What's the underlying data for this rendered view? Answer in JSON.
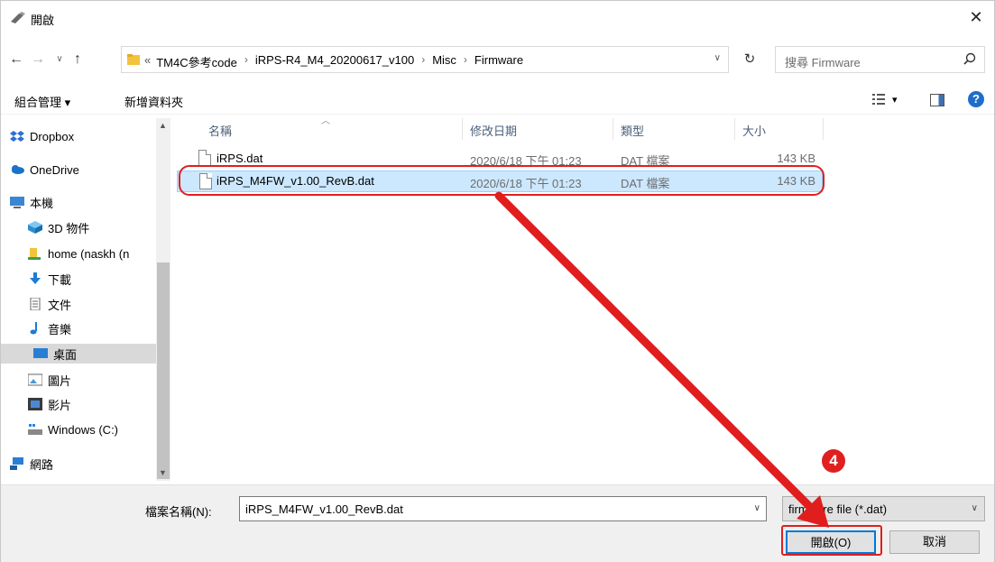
{
  "window": {
    "title": "開啟",
    "close_glyph": "✕"
  },
  "nav": {
    "back": "←",
    "forward": "→",
    "recent": "∨",
    "up": "↑",
    "refresh": "↻"
  },
  "address": {
    "overflow": "«",
    "crumbs": [
      "TM4C參考code",
      "iRPS-R4_M4_20200617_v100",
      "Misc",
      "Firmware"
    ],
    "separator": "›",
    "dropdown": "∨"
  },
  "search": {
    "placeholder": "搜尋 Firmware"
  },
  "toolbar": {
    "organize": "組合管理 ▾",
    "new_folder": "新增資料夾",
    "view_menu": "▾"
  },
  "sidebar": {
    "items": [
      {
        "label": "Dropbox",
        "icon": "dropbox-icon"
      },
      {
        "label": "OneDrive",
        "icon": "cloud-icon"
      },
      {
        "label": "本機",
        "icon": "computer-icon"
      },
      {
        "label": "3D 物件",
        "icon": "cube-icon"
      },
      {
        "label": "home (naskh (n",
        "icon": "user-folder-icon"
      },
      {
        "label": "下載",
        "icon": "download-icon"
      },
      {
        "label": "文件",
        "icon": "document-icon"
      },
      {
        "label": "音樂",
        "icon": "music-icon"
      },
      {
        "label": "桌面",
        "icon": "desktop-icon"
      },
      {
        "label": "圖片",
        "icon": "picture-icon"
      },
      {
        "label": "影片",
        "icon": "video-icon"
      },
      {
        "label": "Windows (C:)",
        "icon": "drive-icon"
      },
      {
        "label": "網路",
        "icon": "network-icon"
      }
    ],
    "selected_index": 8
  },
  "columns": [
    "名稱",
    "修改日期",
    "類型",
    "大小"
  ],
  "files": [
    {
      "name": "iRPS.dat",
      "modified": "2020/6/18 下午 01:23",
      "type": "DAT 檔案",
      "size": "143 KB",
      "selected": false
    },
    {
      "name": "iRPS_M4FW_v1.00_RevB.dat",
      "modified": "2020/6/18 下午 01:23",
      "type": "DAT 檔案",
      "size": "143 KB",
      "selected": true
    }
  ],
  "footer": {
    "filename_label": "檔案名稱(N):",
    "filename_value": "iRPS_M4FW_v1.00_RevB.dat",
    "filter_value": "firmware file (*.dat)",
    "open_label": "開啟(O)",
    "cancel_label": "取消"
  },
  "annotation": {
    "step_number": "4",
    "color": "#e01e1e"
  },
  "colors": {
    "selection_bg": "#cce8ff",
    "selection_border": "#99d1ff",
    "accent": "#0078d7"
  }
}
